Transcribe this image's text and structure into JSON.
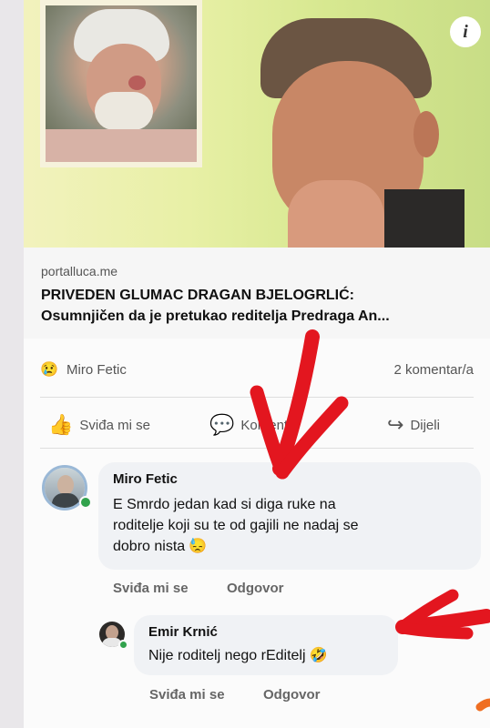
{
  "article": {
    "domain": "portalluca.me",
    "title": "PRIVEDEN GLUMAC DRAGAN BJELOGRLIĆ:\nOsumnjičen da je pretukao reditelja Predraga An...",
    "info_icon": "i"
  },
  "stats": {
    "reaction_icon": "😢",
    "reactor_name": "Miro Fetic",
    "comment_count": "2 komentar/a"
  },
  "actions": {
    "like": {
      "label": "Sviđa mi se",
      "icon": "thumbs-up-icon",
      "glyph": "👍"
    },
    "comment": {
      "label": "Komentar",
      "icon": "comment-icon",
      "glyph": "💬"
    },
    "share": {
      "label": "Dijeli",
      "icon": "share-icon",
      "glyph": "↪"
    }
  },
  "comments": [
    {
      "author": "Miro Fetic",
      "text": "E Smrdo jedan kad si diga ruke na\nroditelje koji su te od gajili ne nadaj se\ndobro nista",
      "emoji": "😓",
      "like_label": "Sviđa mi se",
      "reply_label": "Odgovor"
    },
    {
      "author": "Emir Krnić",
      "text": "Nije roditelj nego rEditelj",
      "emoji": "🤣",
      "like_label": "Sviđa mi se",
      "reply_label": "Odgovor"
    }
  ],
  "annotations": {
    "color": "#e3161f"
  }
}
